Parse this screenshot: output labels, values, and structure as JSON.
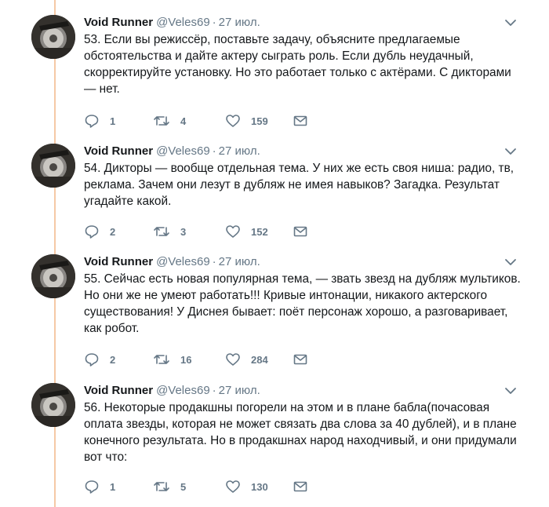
{
  "tweets": [
    {
      "author": "Void Runner",
      "handle": "@Veles69",
      "separator": "·",
      "date": "27 июл.",
      "text": "53. Если вы режиссёр, поставьте задачу, объясните предлагаемые обстоятельства и дайте актеру сыграть роль. Если дубль неудачный, скорректируйте установку. Но это работает только с актёрами. С дикторами — нет.",
      "replies": "1",
      "retweets": "4",
      "likes": "159"
    },
    {
      "author": "Void Runner",
      "handle": "@Veles69",
      "separator": "·",
      "date": "27 июл.",
      "text": "54. Дикторы — вообще отдельная тема. У них же есть своя ниша: радио, тв, реклама. Зачем они лезут в дубляж не имея навыков? Загадка. Результат угадайте какой.",
      "replies": "2",
      "retweets": "3",
      "likes": "152"
    },
    {
      "author": "Void Runner",
      "handle": "@Veles69",
      "separator": "·",
      "date": "27 июл.",
      "text": "55. Сейчас есть новая популярная тема, — звать звезд на дубляж мультиков. Но они же не умеют работать!!! Кривые интонации, никакого актерского существования! У Диснея бывает: поёт персонаж хорошо, а разговаривает, как робот.",
      "replies": "2",
      "retweets": "16",
      "likes": "284"
    },
    {
      "author": "Void Runner",
      "handle": "@Veles69",
      "separator": "·",
      "date": "27 июл.",
      "text": "56. Некоторые продакшны погорели на этом и в плане бабла(почасовая оплата звезды, которая не может связать два слова за 40 дублей), и в плане конечного результата. Но в продакшнах народ находчивый, и они придумали вот что:",
      "replies": "1",
      "retweets": "5",
      "likes": "130"
    }
  ],
  "icons": {
    "reply": "reply-icon",
    "retweet": "retweet-icon",
    "like": "heart-icon",
    "message": "envelope-icon",
    "menu": "chevron-down-icon"
  },
  "colors": {
    "thread_line": "#f5c9a6",
    "secondary_text": "#657786",
    "primary_text": "#14171a"
  }
}
